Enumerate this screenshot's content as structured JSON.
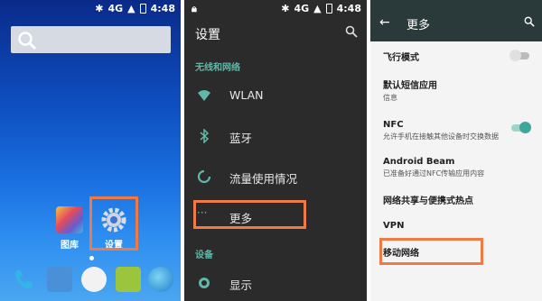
{
  "statusbar": {
    "signal": "4G",
    "time": "4:48"
  },
  "home": {
    "apps": [
      {
        "label": "图库"
      },
      {
        "label": "设置"
      }
    ]
  },
  "settings": {
    "title": "设置",
    "sections": [
      {
        "header": "无线和网络",
        "items": [
          "WLAN",
          "蓝牙",
          "流量使用情况",
          "更多"
        ]
      },
      {
        "header": "设备",
        "items": [
          "显示"
        ]
      }
    ]
  },
  "more": {
    "title": "更多",
    "back_icon": "←",
    "items": [
      {
        "title": "飞行模式",
        "subtitle": ""
      },
      {
        "title": "默认短信应用",
        "subtitle": "信息"
      },
      {
        "title": "NFC",
        "subtitle": "允许手机在接触其他设备时交换数据"
      },
      {
        "title": "Android Beam",
        "subtitle": "已准备好通过NFC传输应用内容"
      },
      {
        "title": "网络共享与便携式热点",
        "subtitle": ""
      },
      {
        "title": "VPN",
        "subtitle": ""
      },
      {
        "title": "移动网络",
        "subtitle": ""
      }
    ]
  },
  "colors": {
    "highlight": "#f07a45",
    "accent": "#5fb8a8",
    "toggle_on": "#3fa79a"
  }
}
